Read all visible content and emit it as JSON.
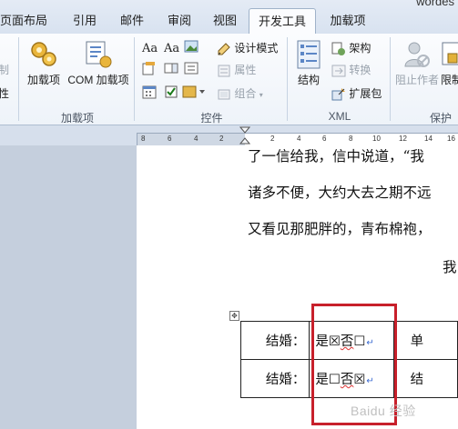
{
  "window": {
    "title_fragment": "wordes"
  },
  "tabs": [
    {
      "label": "页面布局",
      "active": false
    },
    {
      "label": "引用",
      "active": false
    },
    {
      "label": "邮件",
      "active": false
    },
    {
      "label": "审阅",
      "active": false
    },
    {
      "label": "视图",
      "active": false
    },
    {
      "label": "开发工具",
      "active": true
    },
    {
      "label": "加载项",
      "active": false
    }
  ],
  "ribbon": {
    "code_group": {
      "items": [
        "制",
        "性"
      ]
    },
    "addins_group": {
      "label": "加载项",
      "buttons": [
        {
          "label": "加载项",
          "icon": "gear-addins-icon"
        },
        {
          "label": "COM 加载项",
          "icon": "com-addins-icon"
        }
      ]
    },
    "controls_group": {
      "label": "控件",
      "design_mode": "设计模式",
      "properties": "属性",
      "group": "组合"
    },
    "xml_group": {
      "label": "XML",
      "structure": "结构",
      "schema": "架构",
      "transform": "转换",
      "expansion_pack": "扩展包"
    },
    "protect_group": {
      "label": "保护",
      "block_authors": "阻止作者",
      "restrict": "限制"
    }
  },
  "ruler": {
    "ticks": [
      "8",
      "6",
      "4",
      "2",
      "2",
      "4",
      "6",
      "8",
      "10",
      "12",
      "14",
      "16"
    ]
  },
  "document": {
    "lines": [
      "了一信给我，信中说道，“我",
      "诸多不便，大约大去之期不远",
      "又看见那肥胖的，青布棉袍，"
    ],
    "line_tail_char": "我",
    "table": {
      "rows": [
        {
          "label": "结婚：",
          "yes": "是",
          "yes_box": "☒",
          "no": "否",
          "no_box": "☐",
          "next": "单"
        },
        {
          "label": "结婚：",
          "yes": "是",
          "yes_box": "☐",
          "no": "否",
          "no_box": "☒",
          "next": "结"
        }
      ]
    }
  },
  "watermark": "Baidu 经验",
  "colors": {
    "highlight_box": "#c8202b",
    "ribbon_active_tab": "#fbfcfe",
    "canvas": "#c5cfdd"
  }
}
